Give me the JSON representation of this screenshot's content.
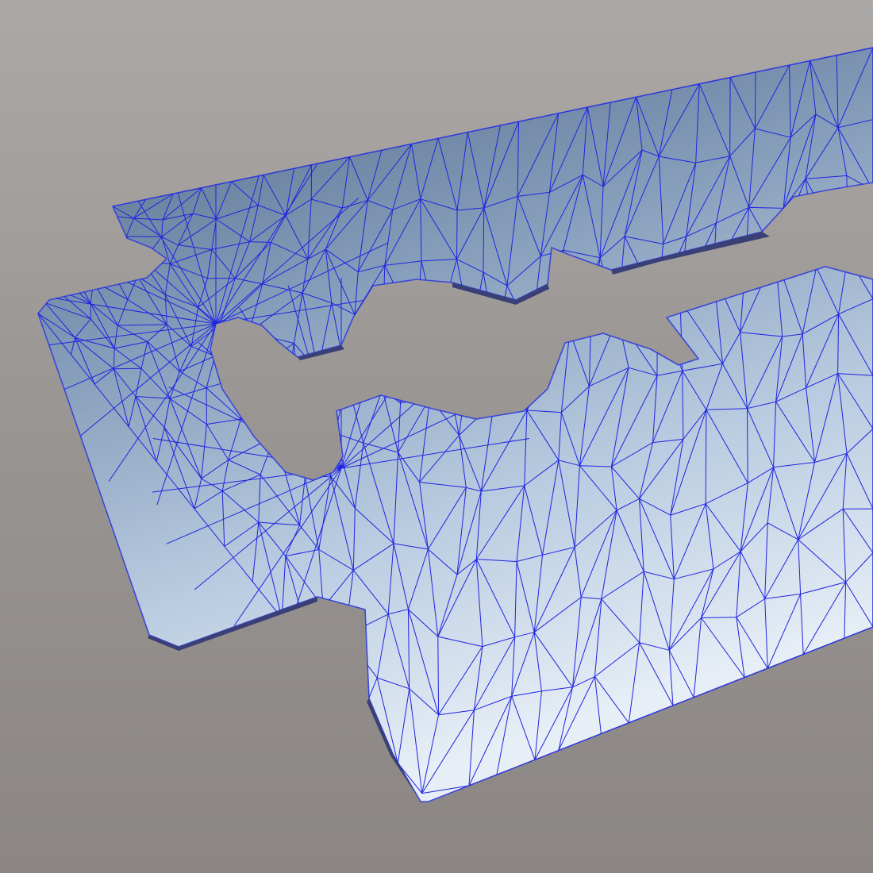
{
  "scene": {
    "subject": "razor-blade-mesh",
    "colors": {
      "background_top": "#aba8a6",
      "background_bottom": "#8b8683",
      "surface_dark": "#4f6680",
      "surface_light": "#e7eef6",
      "edge": "#6b7bb5",
      "wireframe": "#1f24e0"
    }
  }
}
